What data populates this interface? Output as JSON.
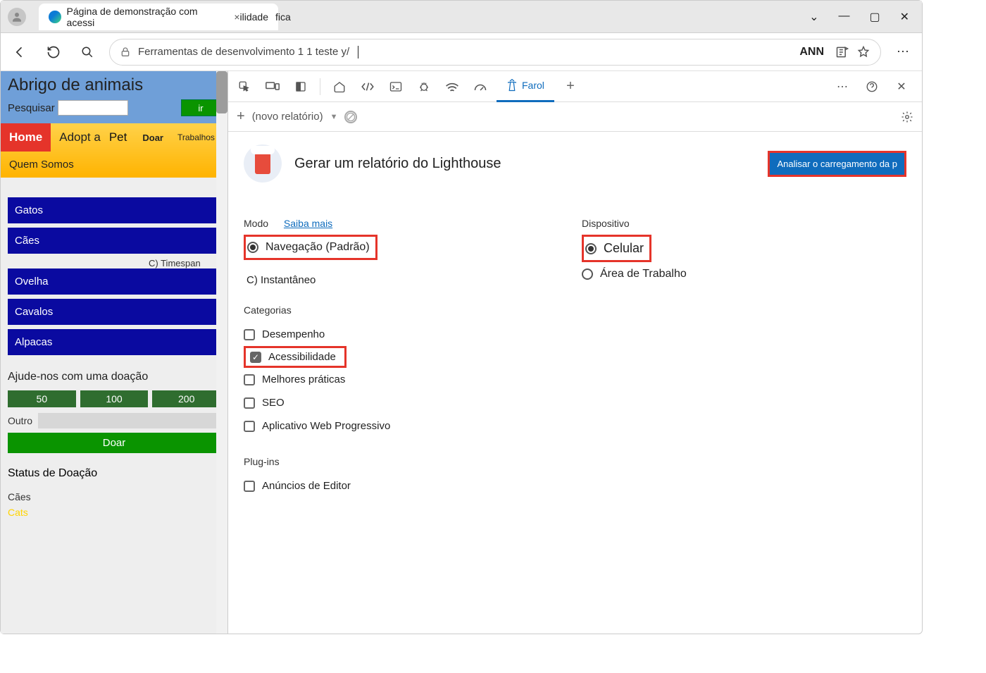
{
  "titlebar": {
    "tab_title": "Página de demonstração com acessi",
    "tab_close": "ilidade",
    "tab_after": "fica"
  },
  "toolbar": {
    "url": "Ferramentas de desenvolvimento 1 1 teste y/",
    "ann": "ANN"
  },
  "page": {
    "title": "Abrigo de animais",
    "search_label": "Pesquisar",
    "go": "ir",
    "nav": {
      "home": "Home",
      "adopt": "Adopt a",
      "pet": "Pet",
      "doar": "Doar",
      "trab": "Trabalhos",
      "quem": "Quem Somos"
    },
    "categories": [
      "Gatos",
      "Cães",
      "Ovelha",
      "Cavalos",
      "Alpacas"
    ],
    "timespan": "C) Timespan",
    "donate_h": "Ajude-nos com uma doação",
    "amounts": [
      "50",
      "100",
      "200"
    ],
    "other": "Outro",
    "donate_btn": "Doar",
    "status_h": "Status de Doação",
    "status1": "Cães",
    "status2": "Cats"
  },
  "dev": {
    "tab": "Farol",
    "report": "(novo relatório)",
    "title": "Gerar um relatório do Lighthouse",
    "analyze": "Analisar o carregamento da p",
    "mode_h": "Modo",
    "learn": "Saiba mais",
    "mode1": "Navegação (Padrão)",
    "mode2": "C) Instantâneo",
    "dev_h": "Dispositivo",
    "dev1": "Celular",
    "dev2": "Área de Trabalho",
    "cat_h": "Categorias",
    "cats": [
      "Desempenho",
      "Acessibilidade",
      "Melhores práticas",
      "SEO",
      "Aplicativo Web Progressivo"
    ],
    "plug_h": "Plug-ins",
    "plug1": "Anúncios de Editor"
  }
}
